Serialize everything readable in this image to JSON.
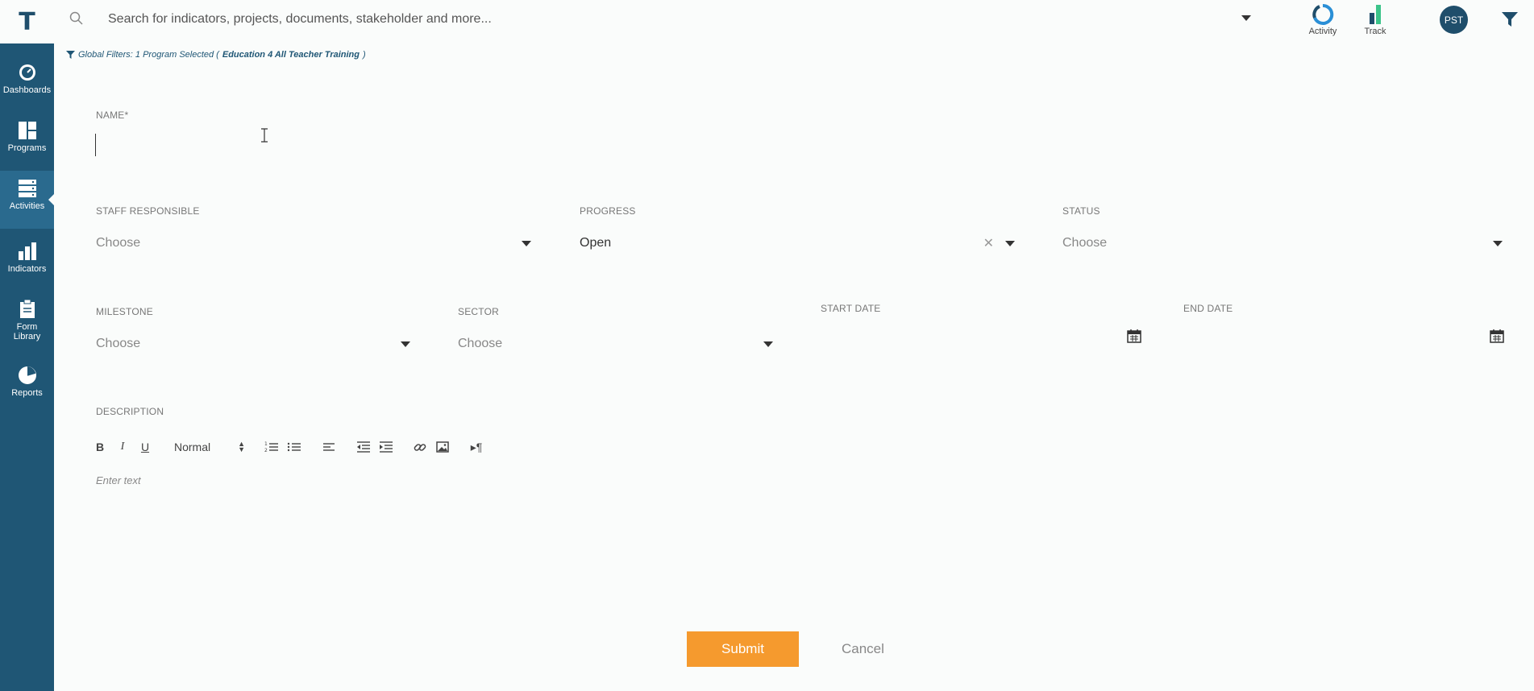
{
  "app": {
    "logo_letter": "T"
  },
  "search": {
    "placeholder": "Search for indicators, projects, documents, stakeholder and more..."
  },
  "header": {
    "activity_label": "Activity",
    "track_label": "Track",
    "avatar_initials": "PST"
  },
  "sidebar": {
    "items": [
      {
        "label": "Dashboards",
        "icon": "gauge-icon"
      },
      {
        "label": "Programs",
        "icon": "layout-icon"
      },
      {
        "label": "Activities",
        "icon": "server-stack-icon",
        "active": true
      },
      {
        "label": "Indicators",
        "icon": "bar-chart-icon"
      },
      {
        "label": "Form Library",
        "icon": "clipboard-icon"
      },
      {
        "label": "Reports",
        "icon": "pie-chart-icon"
      }
    ]
  },
  "global_filter": {
    "prefix": "Global Filters: 1 Program Selected (",
    "program": "Education 4 All Teacher Training",
    "suffix": ")"
  },
  "form": {
    "name_label": "NAME*",
    "staff_label": "STAFF RESPONSIBLE",
    "staff_value": "Choose",
    "progress_label": "PROGRESS",
    "progress_value": "Open",
    "status_label": "STATUS",
    "status_value": "Choose",
    "milestone_label": "MILESTONE",
    "milestone_value": "Choose",
    "sector_label": "SECTOR",
    "sector_value": "Choose",
    "start_date_label": "START DATE",
    "end_date_label": "END DATE",
    "description_label": "DESCRIPTION",
    "editor": {
      "heading_select": "Normal",
      "placeholder": "Enter text"
    },
    "submit_label": "Submit",
    "cancel_label": "Cancel"
  },
  "colors": {
    "sidebar": "#1f5675",
    "sidebar_active": "#2a6a8e",
    "submit": "#f59a2e",
    "brand": "#1f4e6b"
  }
}
